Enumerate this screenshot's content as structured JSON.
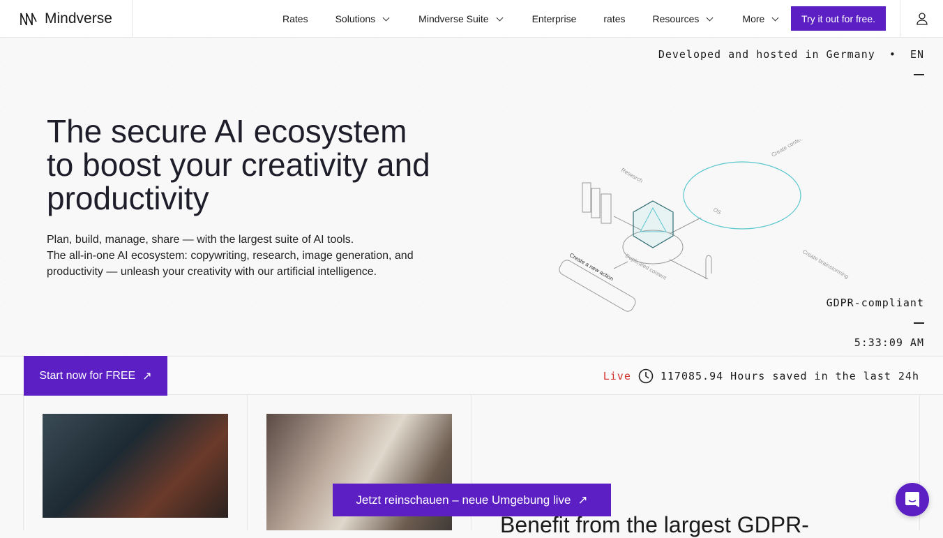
{
  "nav": {
    "brand": "Mindverse",
    "items": [
      {
        "label": "Rates"
      },
      {
        "label": "Solutions"
      },
      {
        "label": "Mindverse Suite"
      },
      {
        "label": "Enterprise"
      },
      {
        "label": "rates"
      },
      {
        "label": "Resources"
      },
      {
        "label": "More"
      }
    ],
    "cta": "Try it out for free."
  },
  "hero": {
    "tagline": "Developed and hosted in Germany",
    "bullet": "•",
    "lang": "EN",
    "title": "The secure AI ecosystem to boost your creativity and productivity",
    "sub1": "Plan, build, manage, share — with the largest suite of AI tools.",
    "sub2": "The all-in-one AI ecosystem: copywriting, research, image generation, and productivity — unleash your creativity with our artificial intelligence.",
    "gdpr": "GDPR-compliant",
    "time": "5:33:09 AM",
    "illustration": {
      "research": "Research",
      "create_content": "Create content",
      "os": "OS",
      "action": "Create a new action",
      "duplicated": "Duplicated content",
      "brainstorm": "Create brainstorming"
    }
  },
  "bar": {
    "start": "Start now for FREE",
    "live": "Live",
    "stat": "117085.94 Hours saved in the last 24h"
  },
  "main": {
    "benefit": "Benefit from the largest GDPR-"
  },
  "banner": {
    "label": "Jetzt reinschauen – neue Umgebung live"
  },
  "colors": {
    "accent": "#5b1fc4",
    "live": "#d0312d"
  }
}
